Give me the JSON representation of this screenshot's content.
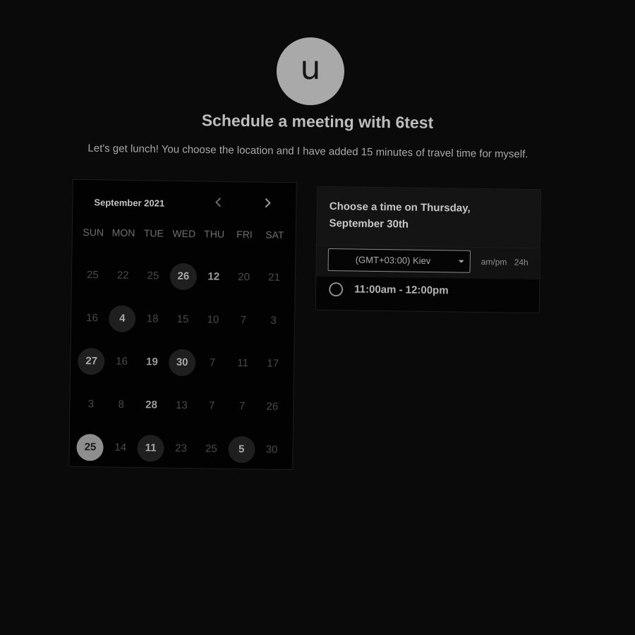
{
  "host": {
    "avatar_letter": "u",
    "title": "Schedule a meeting with 6test",
    "description": "Let's get lunch! You choose the location and I have added 15 minutes of travel time for myself."
  },
  "calendar": {
    "month_label": "September 2021",
    "prev_icon": "chevron-left-icon",
    "next_icon": "chevron-right-icon",
    "weekdays": [
      "SUN",
      "MON",
      "TUE",
      "WED",
      "THU",
      "FRI",
      "SAT"
    ],
    "weeks": [
      [
        "25",
        "22",
        "25",
        "26",
        "12",
        "20",
        "21"
      ],
      [
        "16",
        "4",
        "18",
        "15",
        "10",
        "7",
        "3"
      ],
      [
        "27",
        "16",
        "19",
        "30",
        "7",
        "11",
        "17"
      ],
      [
        "3",
        "8",
        "28",
        "13",
        "7",
        "7",
        "26"
      ],
      [
        "25",
        "14",
        "11",
        "23",
        "25",
        "5",
        "30"
      ]
    ]
  },
  "time_panel": {
    "heading": "Choose a time on Thursday, September 30th",
    "timezone": "(GMT+03:00) Kiev",
    "format_ampm": "am/pm",
    "format_24h": "24h",
    "slots": [
      "11:00am - 12:00pm"
    ]
  },
  "colors": {
    "background": "#0a0a0a",
    "accent": "#8e8e8e"
  }
}
